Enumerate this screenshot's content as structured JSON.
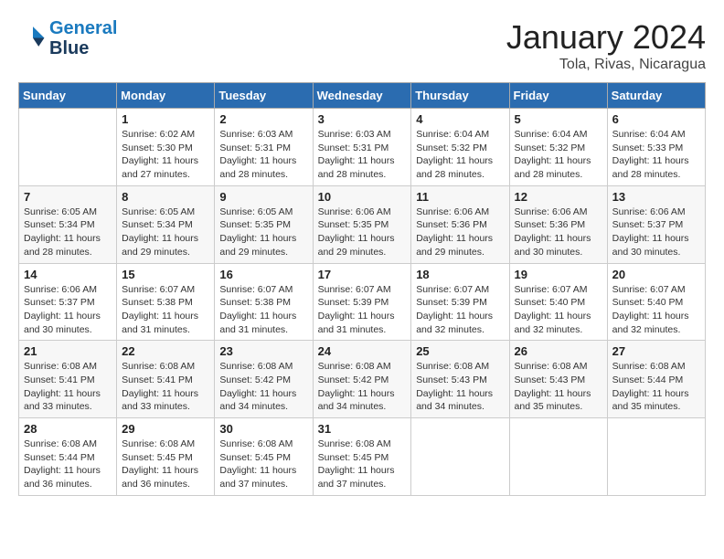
{
  "header": {
    "logo_line1": "General",
    "logo_line2": "Blue",
    "month": "January 2024",
    "location": "Tola, Rivas, Nicaragua"
  },
  "weekdays": [
    "Sunday",
    "Monday",
    "Tuesday",
    "Wednesday",
    "Thursday",
    "Friday",
    "Saturday"
  ],
  "weeks": [
    [
      {
        "day": "",
        "info": ""
      },
      {
        "day": "1",
        "info": "Sunrise: 6:02 AM\nSunset: 5:30 PM\nDaylight: 11 hours\nand 27 minutes."
      },
      {
        "day": "2",
        "info": "Sunrise: 6:03 AM\nSunset: 5:31 PM\nDaylight: 11 hours\nand 28 minutes."
      },
      {
        "day": "3",
        "info": "Sunrise: 6:03 AM\nSunset: 5:31 PM\nDaylight: 11 hours\nand 28 minutes."
      },
      {
        "day": "4",
        "info": "Sunrise: 6:04 AM\nSunset: 5:32 PM\nDaylight: 11 hours\nand 28 minutes."
      },
      {
        "day": "5",
        "info": "Sunrise: 6:04 AM\nSunset: 5:32 PM\nDaylight: 11 hours\nand 28 minutes."
      },
      {
        "day": "6",
        "info": "Sunrise: 6:04 AM\nSunset: 5:33 PM\nDaylight: 11 hours\nand 28 minutes."
      }
    ],
    [
      {
        "day": "7",
        "info": "Sunrise: 6:05 AM\nSunset: 5:34 PM\nDaylight: 11 hours\nand 28 minutes."
      },
      {
        "day": "8",
        "info": "Sunrise: 6:05 AM\nSunset: 5:34 PM\nDaylight: 11 hours\nand 29 minutes."
      },
      {
        "day": "9",
        "info": "Sunrise: 6:05 AM\nSunset: 5:35 PM\nDaylight: 11 hours\nand 29 minutes."
      },
      {
        "day": "10",
        "info": "Sunrise: 6:06 AM\nSunset: 5:35 PM\nDaylight: 11 hours\nand 29 minutes."
      },
      {
        "day": "11",
        "info": "Sunrise: 6:06 AM\nSunset: 5:36 PM\nDaylight: 11 hours\nand 29 minutes."
      },
      {
        "day": "12",
        "info": "Sunrise: 6:06 AM\nSunset: 5:36 PM\nDaylight: 11 hours\nand 30 minutes."
      },
      {
        "day": "13",
        "info": "Sunrise: 6:06 AM\nSunset: 5:37 PM\nDaylight: 11 hours\nand 30 minutes."
      }
    ],
    [
      {
        "day": "14",
        "info": "Sunrise: 6:06 AM\nSunset: 5:37 PM\nDaylight: 11 hours\nand 30 minutes."
      },
      {
        "day": "15",
        "info": "Sunrise: 6:07 AM\nSunset: 5:38 PM\nDaylight: 11 hours\nand 31 minutes."
      },
      {
        "day": "16",
        "info": "Sunrise: 6:07 AM\nSunset: 5:38 PM\nDaylight: 11 hours\nand 31 minutes."
      },
      {
        "day": "17",
        "info": "Sunrise: 6:07 AM\nSunset: 5:39 PM\nDaylight: 11 hours\nand 31 minutes."
      },
      {
        "day": "18",
        "info": "Sunrise: 6:07 AM\nSunset: 5:39 PM\nDaylight: 11 hours\nand 32 minutes."
      },
      {
        "day": "19",
        "info": "Sunrise: 6:07 AM\nSunset: 5:40 PM\nDaylight: 11 hours\nand 32 minutes."
      },
      {
        "day": "20",
        "info": "Sunrise: 6:07 AM\nSunset: 5:40 PM\nDaylight: 11 hours\nand 32 minutes."
      }
    ],
    [
      {
        "day": "21",
        "info": "Sunrise: 6:08 AM\nSunset: 5:41 PM\nDaylight: 11 hours\nand 33 minutes."
      },
      {
        "day": "22",
        "info": "Sunrise: 6:08 AM\nSunset: 5:41 PM\nDaylight: 11 hours\nand 33 minutes."
      },
      {
        "day": "23",
        "info": "Sunrise: 6:08 AM\nSunset: 5:42 PM\nDaylight: 11 hours\nand 34 minutes."
      },
      {
        "day": "24",
        "info": "Sunrise: 6:08 AM\nSunset: 5:42 PM\nDaylight: 11 hours\nand 34 minutes."
      },
      {
        "day": "25",
        "info": "Sunrise: 6:08 AM\nSunset: 5:43 PM\nDaylight: 11 hours\nand 34 minutes."
      },
      {
        "day": "26",
        "info": "Sunrise: 6:08 AM\nSunset: 5:43 PM\nDaylight: 11 hours\nand 35 minutes."
      },
      {
        "day": "27",
        "info": "Sunrise: 6:08 AM\nSunset: 5:44 PM\nDaylight: 11 hours\nand 35 minutes."
      }
    ],
    [
      {
        "day": "28",
        "info": "Sunrise: 6:08 AM\nSunset: 5:44 PM\nDaylight: 11 hours\nand 36 minutes."
      },
      {
        "day": "29",
        "info": "Sunrise: 6:08 AM\nSunset: 5:45 PM\nDaylight: 11 hours\nand 36 minutes."
      },
      {
        "day": "30",
        "info": "Sunrise: 6:08 AM\nSunset: 5:45 PM\nDaylight: 11 hours\nand 37 minutes."
      },
      {
        "day": "31",
        "info": "Sunrise: 6:08 AM\nSunset: 5:45 PM\nDaylight: 11 hours\nand 37 minutes."
      },
      {
        "day": "",
        "info": ""
      },
      {
        "day": "",
        "info": ""
      },
      {
        "day": "",
        "info": ""
      }
    ]
  ]
}
